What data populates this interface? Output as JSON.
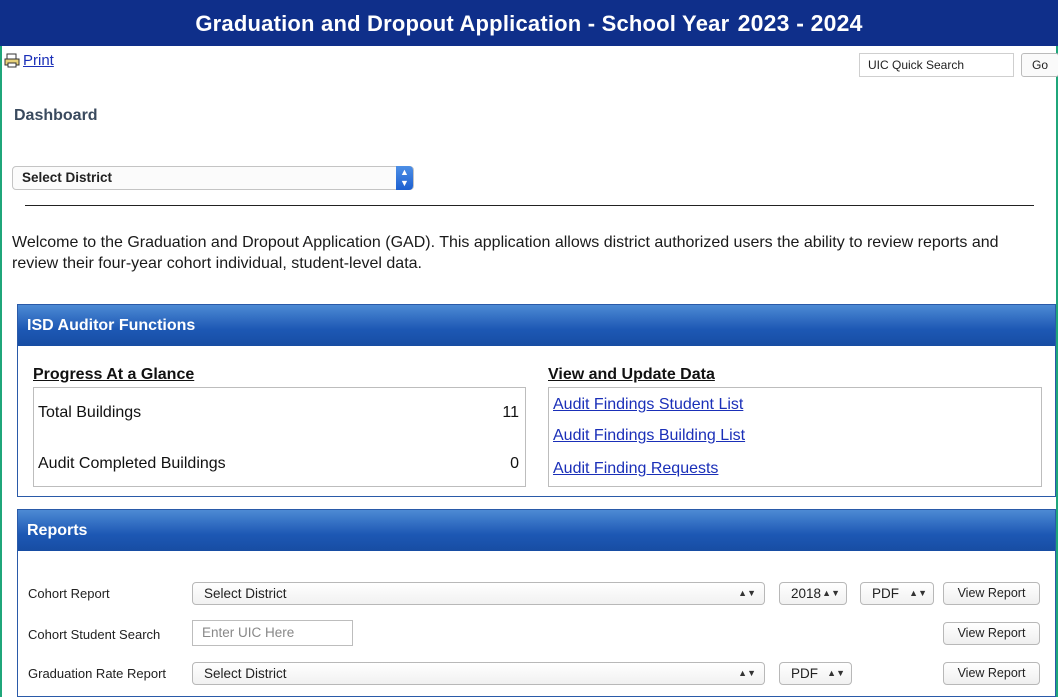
{
  "header": {
    "title": "Graduation and Dropout Application - School Year",
    "year": "2023 - 2024"
  },
  "toolbar": {
    "print_label": "Print",
    "quick_search_value": "UIC Quick Search",
    "go_label": "Go"
  },
  "page": {
    "heading": "Dashboard",
    "district_select": "Select District",
    "welcome_text": "Welcome to the Graduation and Dropout Application (GAD). This application allows district authorized users the ability to review reports and review their four-year cohort individual, student-level data."
  },
  "isd_panel": {
    "title": "ISD Auditor Functions",
    "progress": {
      "title": "Progress At a Glance",
      "rows": [
        {
          "label": "Total Buildings",
          "value": "11"
        },
        {
          "label": "Audit Completed Buildings",
          "value": "0"
        }
      ]
    },
    "view_update": {
      "title": "View and Update Data",
      "links": [
        "Audit Findings Student List",
        "Audit Findings Building List",
        "Audit Finding Requests"
      ]
    }
  },
  "reports_panel": {
    "title": "Reports",
    "rows": [
      {
        "label": "Cohort Report",
        "district": "Select District",
        "year": "2018",
        "format": "PDF",
        "button": "View Report"
      },
      {
        "label": "Cohort Student Search",
        "placeholder": "Enter UIC Here",
        "button": "View Report"
      },
      {
        "label": "Graduation Rate Report",
        "district": "Select District",
        "format": "PDF",
        "button": "View Report"
      }
    ]
  },
  "colors": {
    "title_bar": "#0f2f8a",
    "panel_header": "#1d58b4",
    "link": "#1a2fb8",
    "frame": "#1fa67a"
  }
}
